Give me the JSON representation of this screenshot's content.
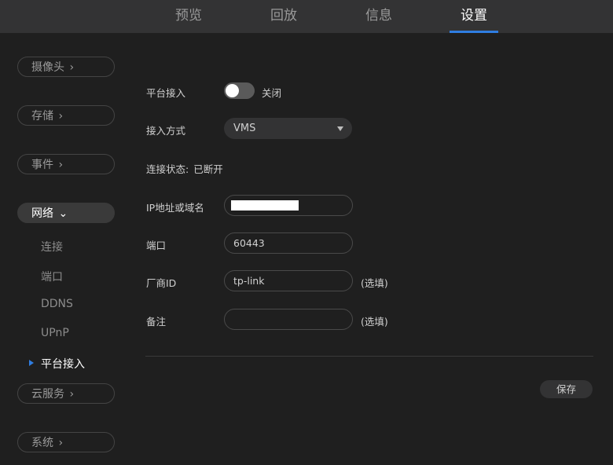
{
  "tabs": [
    {
      "label": "预览"
    },
    {
      "label": "回放"
    },
    {
      "label": "信息"
    },
    {
      "label": "设置",
      "active": true
    }
  ],
  "sidebar": {
    "camera": "摄像头",
    "storage": "存储",
    "event": "事件",
    "network": "网络",
    "network_sub": [
      "连接",
      "端口",
      "DDNS",
      "UPnP",
      "平台接入"
    ],
    "cloud": "云服务",
    "system": "系统",
    "chevron_right": "›",
    "chevron_down": "⌄"
  },
  "form": {
    "platform_access_label": "平台接入",
    "platform_access_state": "关闭",
    "platform_access_on": false,
    "access_mode_label": "接入方式",
    "access_mode_value": "VMS",
    "connection_status_label": "连接状态:",
    "connection_status_value": "已断开",
    "ip_label": "IP地址或域名",
    "port_label": "端口",
    "port_value": "60443",
    "vendor_label": "厂商ID",
    "vendor_value": "tp-link",
    "vendor_hint": "(选填)",
    "remark_label": "备注",
    "remark_value": "",
    "remark_hint": "(选填)"
  },
  "actions": {
    "save_label": "保存"
  },
  "colors": {
    "accent": "#2f7de1",
    "background": "#1f1f1f",
    "topbar": "#333334"
  }
}
